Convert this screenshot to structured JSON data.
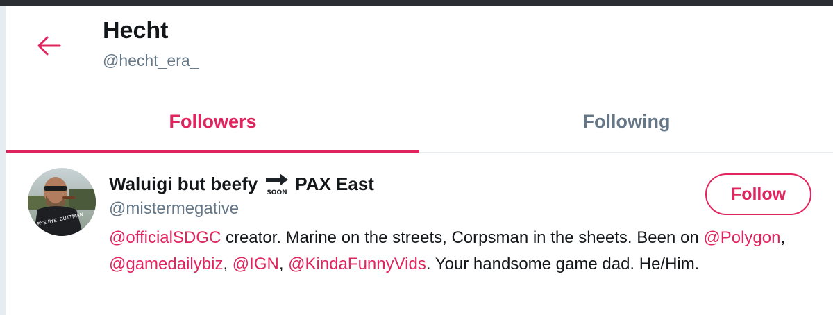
{
  "header": {
    "title": "Hecht",
    "handle": "@hecht_era_"
  },
  "tabs": [
    {
      "label": "Followers",
      "active": true
    },
    {
      "label": "Following",
      "active": false
    }
  ],
  "user": {
    "name_part1": "Waluigi but beefy",
    "emoji_text": "SOON",
    "name_part2": "PAX East",
    "username": "@mistermegative",
    "follow_label": "Follow",
    "avatar_text": "BYE BYE, BUTTMAN",
    "bio": {
      "m1": "@officialSDGC",
      "t1": " creator. Marine on the streets, Corpsman in the sheets. Been on ",
      "m2": "@Polygon",
      "t2": ", ",
      "m3": "@gamedailybiz",
      "t3": ", ",
      "m4": "@IGN",
      "t4": ", ",
      "m5": "@KindaFunnyVids",
      "t5": ". Your handsome game dad. He/Him."
    }
  },
  "colors": {
    "accent": "#e0245e",
    "secondary_text": "#657786",
    "primary_text": "#14171a"
  }
}
